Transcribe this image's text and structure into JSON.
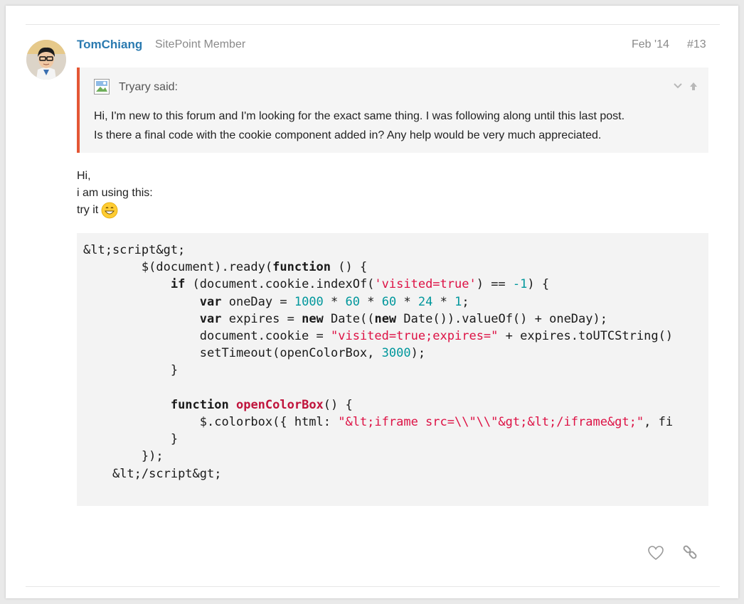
{
  "post": {
    "username": "TomChiang",
    "user_title": "SitePoint Member",
    "date": "Feb '14",
    "number": "#13",
    "avatar_icon": "user-avatar"
  },
  "quote": {
    "author": "Tryary said:",
    "image_icon": "broken-image-icon",
    "text_line1": "Hi, I'm new to this forum and I'm looking for the exact same thing. I was following along until this last post.",
    "text_line2": "Is there a final code with the cookie component added in? Any help would be very much appreciated.",
    "accent_color": "#e45735"
  },
  "reply": {
    "line1": "Hi,",
    "line2": "i am using this:",
    "line3": "try it",
    "emoji": "grinning-face-emoji"
  },
  "code": {
    "l1": "&lt;script&gt;",
    "l2_a": "        $(document).ready(",
    "l2_kw": "function",
    "l2_b": " () {",
    "l3_kw": "if",
    "l3_a": " (document.cookie.indexOf(",
    "l3_str": "'visited=true'",
    "l3_b": ") == ",
    "l3_num": "-1",
    "l3_c": ") {",
    "l4_kw": "var",
    "l4_a": " oneDay = ",
    "l4_n1": "1000",
    "l4_n2": "60",
    "l4_n3": "60",
    "l4_n4": "24",
    "l4_n5": "1",
    "l5_kw1": "var",
    "l5_a": " expires = ",
    "l5_kw2": "new",
    "l5_b": " Date((",
    "l5_kw3": "new",
    "l5_c": " Date()).valueOf() + oneDay);",
    "l6_a": "document.cookie = ",
    "l6_str": "\"visited=true;expires=\"",
    "l6_b": " + expires.toUTCString()",
    "l7_a": "setTimeout(openColorBox, ",
    "l7_num": "3000",
    "l7_b": ");",
    "l8": "}",
    "l10_kw": "function",
    "l10_fn": "openColorBox",
    "l10_a": "() {",
    "l11_a": "$.colorbox({ html: ",
    "l11_str": "\"&lt;iframe src=\\\\\"\\\\\"&gt;&lt;/iframe&gt;\"",
    "l11_b": ", fi",
    "l12": "}",
    "l13": "});",
    "l14": "&lt;/script&gt;"
  },
  "actions": {
    "like_icon": "heart-icon",
    "share_icon": "link-icon"
  },
  "colors": {
    "username": "#2a7ab0",
    "muted": "#8a8a8a",
    "code_bg": "#f3f3f3",
    "string": "#d14",
    "number": "#00979c"
  }
}
